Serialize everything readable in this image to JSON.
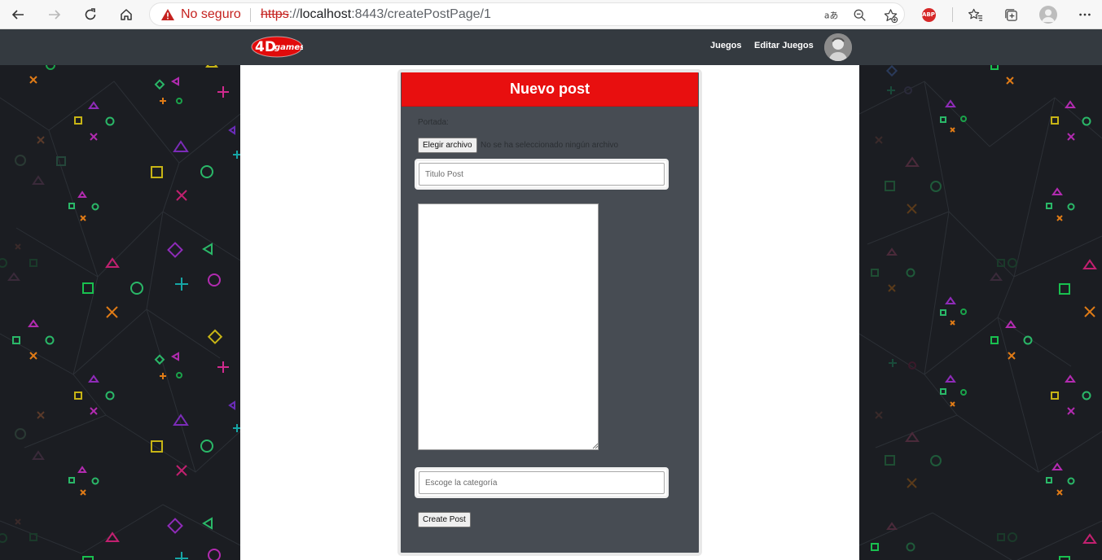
{
  "browser": {
    "not_secure_label": "No seguro",
    "url_scheme": "https",
    "url_sep": "://",
    "url_host": "localhost",
    "url_rest": ":8443/createPostPage/1",
    "icons": [
      "back-arrow-icon",
      "forward-arrow-icon",
      "reload-icon",
      "home-icon",
      "warning-icon",
      "read-aloud-icon",
      "zoom-icon",
      "add-favorite-icon",
      "adblock-icon",
      "favorites-icon",
      "collections-icon",
      "profile-icon",
      "more-icon"
    ],
    "adblock_label": "ABP"
  },
  "site": {
    "logo_text": "4Dgames",
    "nav_links": [
      "Juegos",
      "Editar Juegos"
    ]
  },
  "form": {
    "title": "Nuevo post",
    "cover_label": "Portada:",
    "file_button": "Elegir archivo",
    "file_status": "No se ha seleccionado ningún archivo",
    "title_placeholder": "Titulo Post",
    "category_placeholder": "Escoge la categoría",
    "submit_label": "Create Post"
  },
  "colors": {
    "header_red": "#e80f0f",
    "card_bg": "#474c53",
    "navbar_bg": "#343a40",
    "pattern_bg": "#1b1d22"
  }
}
